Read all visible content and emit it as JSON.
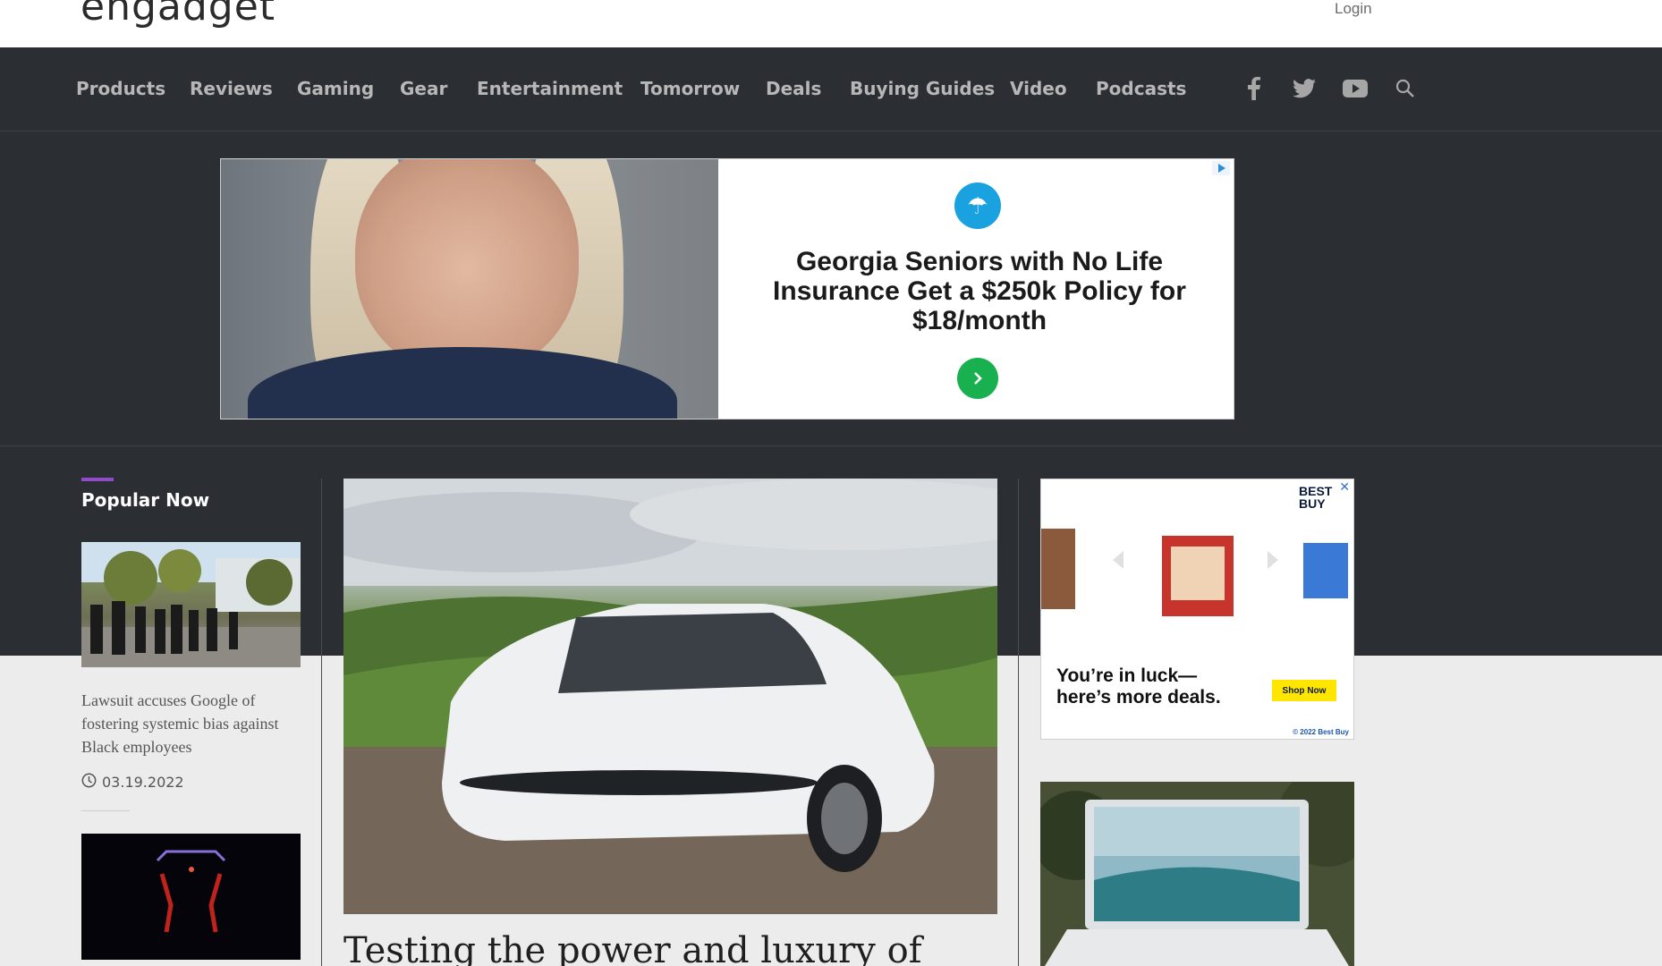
{
  "header": {
    "logo_text": "engadget",
    "login_label": "Login"
  },
  "nav": {
    "items": [
      "Products",
      "Reviews",
      "Gaming",
      "Gear",
      "Entertainment",
      "Tomorrow",
      "Deals",
      "Buying Guides",
      "Video",
      "Podcasts"
    ],
    "icons": [
      "facebook-icon",
      "twitter-icon",
      "youtube-icon",
      "search-icon"
    ]
  },
  "ad_banner": {
    "headline": "Georgia Seniors with No Life Insurance Get a $250k Policy for $18/month",
    "icons": [
      "umbrella-logo-icon",
      "arrow-right-icon",
      "adchoices-icon"
    ]
  },
  "popular": {
    "heading": "Popular Now",
    "items": [
      {
        "title": "Lawsuit accuses Google of fostering systemic bias against Black employees",
        "date": "03.19.2022"
      },
      {
        "title": "",
        "date": ""
      }
    ]
  },
  "hero": {
    "title": "Testing the power and luxury of"
  },
  "side_ad": {
    "brand": "BEST BUY",
    "tagline": "You’re in luck—here’s more deals.",
    "cta": "Shop Now",
    "copyright": "© 2022 Best Buy"
  },
  "colors": {
    "nav_bg": "#2b2e33",
    "accent": "#8f4cc6",
    "ad_cta_green": "#19b04f",
    "bestbuy_yellow": "#ffe600"
  }
}
